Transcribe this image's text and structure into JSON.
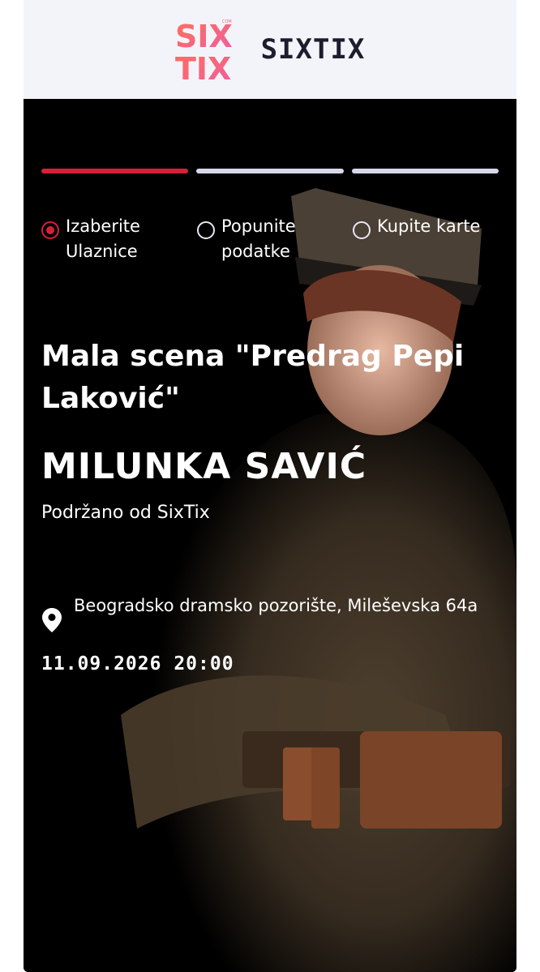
{
  "header": {
    "logo_top": "SIX",
    "logo_bottom": "TIX",
    "logo_small": "COM",
    "brand": "SIXTIX"
  },
  "progress": {
    "active_step": 1,
    "total_steps": 3
  },
  "steps": [
    {
      "label": "Izaberite\nUlaznice",
      "active": true
    },
    {
      "label": "Popunite\npodatke",
      "active": false
    },
    {
      "label": "Kupite karte",
      "active": false
    }
  ],
  "event": {
    "title": "Mala scena \"Predrag Pepi Laković\"",
    "headliner": "MILUNKA SAVIĆ",
    "supported_by": "Podržano od SixTix",
    "venue": "Beogradsko dramsko pozorište, Mileševska 64a",
    "datetime": "11.09.2026 20:00"
  },
  "colors": {
    "accent": "#d4203a",
    "background": "#000000",
    "topbar": "#f3f4f9",
    "logo_gradient_start": "#ff5a6b",
    "logo_gradient_end": "#f06fa0"
  },
  "icons": {
    "location": "map-pin-icon"
  }
}
